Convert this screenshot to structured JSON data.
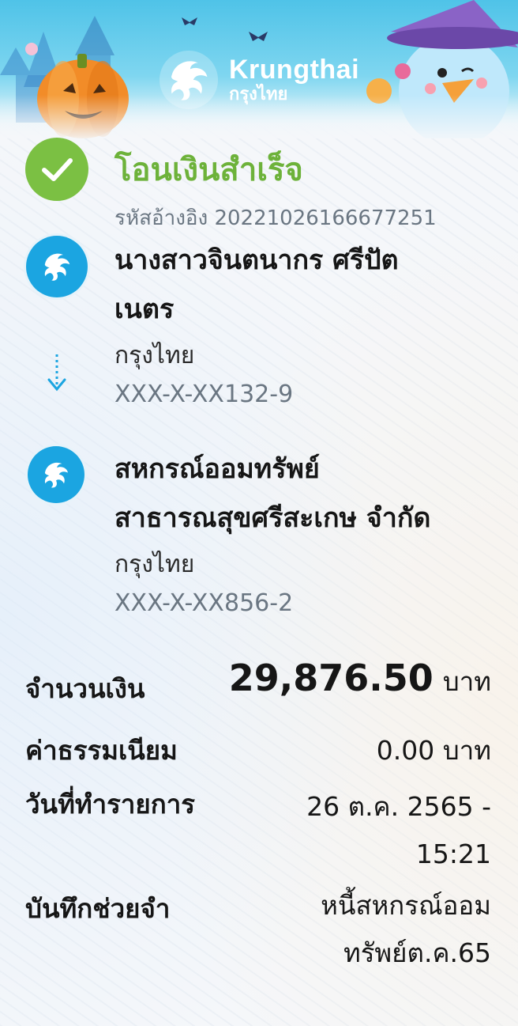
{
  "header": {
    "logo_en": "Krungthai",
    "logo_th": "กรุงไทย"
  },
  "status": {
    "title": "โอนเงินสำเร็จ",
    "ref_label": "รหัสอ้างอิง",
    "ref_no": "2022102616667725​1"
  },
  "sender": {
    "name_line1": "นางสาวจินตนากร ศรีปัต",
    "name_line2": "เนตร",
    "bank": "กรุงไทย",
    "account": "XXX-X-XX132-9"
  },
  "receiver": {
    "name_line1": "สหกรณ์ออมทรัพย์",
    "name_line2": "สาธารณสุขศรีสะเกษ จำกัด",
    "bank": "กรุงไทย",
    "account": "XXX-X-XX856-2"
  },
  "details": {
    "amount_label": "จำนวนเงิน",
    "amount": "29,876.50",
    "amount_unit": "บาท",
    "fee_label": "ค่าธรรมเนียม",
    "fee": "0.00 บาท",
    "date_label": "วันที่ทำรายการ",
    "date_line1": "26 ต.ค. 2565 -",
    "date_line2": "15:21",
    "memo_label": "บันทึกช่วยจำ",
    "memo_line1": "หนี้สหกรณ์ออม",
    "memo_line2": "ทรัพย์ต.ค.65"
  },
  "colors": {
    "success": "#6db23a",
    "brand": "#1ba5e1"
  },
  "icons": {
    "status": "check-icon",
    "bank": "krungthai-bird-icon",
    "flow": "arrow-down-icon"
  }
}
